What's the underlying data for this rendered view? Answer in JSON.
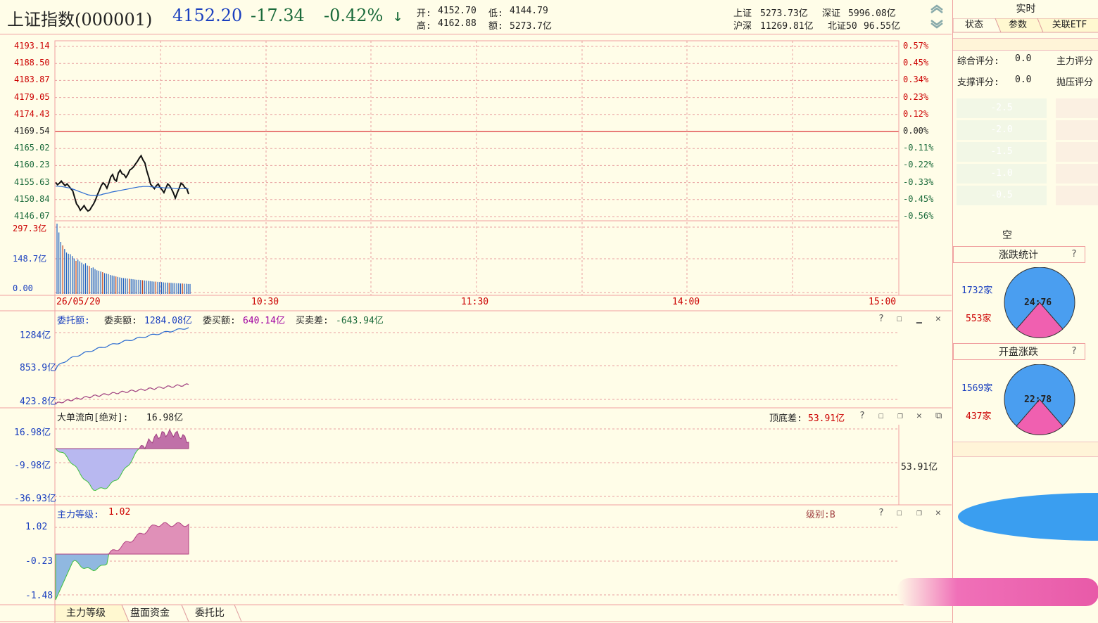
{
  "header": {
    "name": "上证指数(000001)",
    "price": "4152.20",
    "change": "-17.34",
    "pct": "-0.42%",
    "arrow": "↓",
    "open_label": "开:",
    "open": "4152.70",
    "low_label": "低:",
    "low": "4144.79",
    "high_label": "高:",
    "high": "4162.88",
    "amt_label": "额:",
    "amt": "5273.7亿",
    "sh_label": "上证",
    "sh": "5273.73亿",
    "sz_label": "深证",
    "sz": "5996.08亿",
    "hs_label": "沪深",
    "hs": "11269.81亿",
    "bz_label": "北证50",
    "bz": "96.55亿"
  },
  "price_axis": {
    "left": [
      "4193.14",
      "4188.50",
      "4183.87",
      "4179.05",
      "4174.43",
      "4169.54",
      "4165.02",
      "4160.23",
      "4155.63",
      "4150.84",
      "4146.07"
    ],
    "right": [
      "0.57%",
      "0.45%",
      "0.34%",
      "0.23%",
      "0.12%",
      "0.00%",
      "-0.11%",
      "-0.22%",
      "-0.33%",
      "-0.45%",
      "-0.56%"
    ]
  },
  "volume_axis": [
    "297.3亿",
    "148.7亿",
    "0.00"
  ],
  "time_axis": [
    "26/05/20",
    "10:30",
    "11:30",
    "14:00",
    "15:00"
  ],
  "entrust": {
    "title": "委托额:",
    "sell_label": "委卖额:",
    "sell": "1284.08亿",
    "buy_label": "委买额:",
    "buy": "640.14亿",
    "diff_label": "买卖差:",
    "diff": "-643.94亿",
    "axis": [
      "1284亿",
      "853.9亿",
      "423.8亿"
    ]
  },
  "bigorder": {
    "title": "大单流向[绝对]:",
    "value": "16.98亿",
    "diff_label": "顶底差:",
    "diff": "53.91亿",
    "right_value": "53.91亿",
    "axis": [
      "16.98亿",
      "-9.98亿",
      "-36.93亿"
    ]
  },
  "mainforce": {
    "title": "主力等级:",
    "value": "1.02",
    "level_label": "级别:B",
    "axis": [
      "1.02",
      "-0.23",
      "-1.48"
    ]
  },
  "bottom_tabs": [
    "主力等级",
    "盘面资金",
    "委托比"
  ],
  "right_panel": {
    "top_title": "实时",
    "tabs": [
      "状态",
      "参数",
      "关联ETF"
    ],
    "score1_label": "综合评分:",
    "score1": "0.0",
    "score2_label": "主力评分",
    "score3_label": "支撑评分:",
    "score3": "0.0",
    "score4_label": "抛压评分",
    "bars": [
      "-2.5",
      "-2.0",
      "-1.5",
      "-1.0",
      "-0.5"
    ],
    "empty_label": "空",
    "stat_title": "涨跌统计",
    "stat_up": "1732家",
    "stat_down": "553家",
    "stat_ratio": "24:76",
    "open_title": "开盘涨跌",
    "open_up": "1569家",
    "open_down": "437家",
    "open_ratio": "22:78",
    "help": "?"
  },
  "colors": {
    "bg": "#fffde8",
    "grid": "#e8a0a0",
    "up": "#c00000",
    "down": "#1a3fbf",
    "pie_blue": "#4a9ef0",
    "pie_pink": "#f060b0"
  },
  "chart_data": {
    "type": "line",
    "title": "",
    "series": [
      {
        "name": "",
        "values": [
          4155.5,
          4154.9,
          4155.3,
          4155.9,
          4155.2,
          4154.6,
          4155.1,
          4154.5,
          4153.8,
          4153.2,
          4151.4,
          4149.6,
          4148.9,
          4147.8,
          4148.4,
          4149.1,
          4148.2,
          4147.6,
          4147.9,
          4148.8,
          4149.6,
          4150.7,
          4152.1,
          4153.3,
          4154.6,
          4155.4,
          4154.9,
          4153.9,
          4155.3,
          4157.0,
          4157.7,
          4156.3,
          4155.9,
          4158.1,
          4158.9,
          4157.9,
          4157.7,
          4156.9,
          4157.7,
          4158.9,
          4159.3,
          4159.8,
          4160.6,
          4161.3,
          4162.2,
          4162.9,
          4161.7,
          4160.9,
          4158.7,
          4157.0,
          4155.0,
          4154.4,
          4153.8,
          4154.6,
          4155.1,
          4154.1,
          4153.5,
          4152.7,
          4153.9,
          4155.1,
          4154.6,
          4153.7,
          4152.6,
          4151.2,
          4152.6,
          4153.9,
          4155.3,
          4154.9,
          4154.1,
          4153.8,
          4152.3
        ]
      },
      {
        "name": "",
        "values": [
          4154.5,
          4154.5,
          4154.4,
          4154.4,
          4154.3,
          4154.2,
          4154.1,
          4154.0,
          4153.9,
          4153.7,
          4153.5,
          4153.3,
          4153.1,
          4152.9,
          4152.7,
          4152.5,
          4152.3,
          4152.1,
          4152.0,
          4151.9,
          4151.9,
          4151.9,
          4152.0,
          4152.0,
          4152.1,
          4152.3,
          4152.4,
          4152.5,
          4152.6,
          4152.8,
          4152.9,
          4153.0,
          4153.1,
          4153.2,
          4153.3,
          4153.4,
          4153.5,
          4153.6,
          4153.7,
          4153.8,
          4153.9,
          4154.0,
          4154.1,
          4154.2,
          4154.3,
          4154.3,
          4154.4,
          4154.4,
          4154.4,
          4154.4,
          4154.3,
          4154.3,
          4154.2,
          4154.2,
          4154.2,
          4154.1,
          4154.1,
          4154.0,
          4154.0,
          4154.0,
          4154.0,
          4153.9,
          4153.9,
          4153.8,
          4153.8,
          4153.8,
          4153.8,
          4153.8,
          4153.8,
          4153.8,
          4153.7
        ]
      }
    ],
    "ylim": [
      4146.07,
      4193.14
    ],
    "volume": [
      297,
      260,
      220,
      205,
      190,
      175,
      170,
      168,
      160,
      150,
      140,
      145,
      138,
      132,
      125,
      130,
      120,
      118,
      110,
      112,
      105,
      100,
      98,
      95,
      92,
      88,
      86,
      84,
      80,
      78,
      76,
      74,
      72,
      70,
      68,
      67,
      66,
      65,
      64,
      63,
      62,
      61,
      60,
      60,
      59,
      58,
      57,
      56,
      55,
      54,
      53,
      52,
      52,
      51,
      50,
      50,
      49,
      48,
      48,
      47,
      47,
      46,
      46,
      45,
      45,
      44,
      44,
      43,
      43,
      42,
      42
    ]
  }
}
